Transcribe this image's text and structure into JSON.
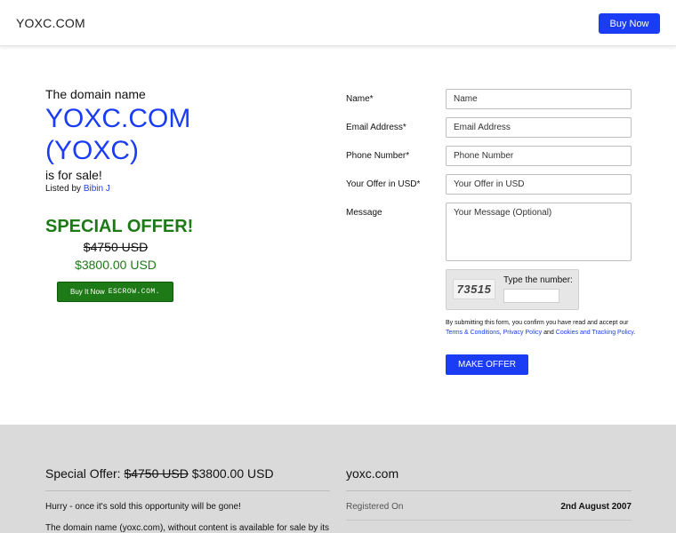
{
  "header": {
    "logo": "YOXC.COM",
    "buy_now_label": "Buy Now"
  },
  "listing": {
    "intro": "The domain name",
    "domain_line1": "YOXC.COM",
    "domain_line2": "(YOXC)",
    "for_sale": "is for sale!",
    "listed_by_prefix": "Listed by",
    "seller": "Bibin J"
  },
  "offer": {
    "special_label": "SPECIAL OFFER!",
    "old_price": "$4750 USD",
    "new_price": "$3800.00 USD",
    "escrow_button": {
      "prefix": "Buy It Now",
      "brand": "ESCROW.COM."
    }
  },
  "form": {
    "fields": [
      {
        "label": "Name*",
        "placeholder": "Name"
      },
      {
        "label": "Email Address*",
        "placeholder": "Email Address"
      },
      {
        "label": "Phone Number*",
        "placeholder": "Phone Number"
      },
      {
        "label": "Your Offer in USD*",
        "placeholder": "Your Offer in USD"
      }
    ],
    "message": {
      "label": "Message",
      "placeholder": "Your Message (Optional)"
    },
    "captcha": {
      "code": "73515",
      "label": "Type the number:"
    },
    "consent": {
      "text_before": "By submitting this form, you confirm you have read and accept our",
      "terms_link": "Terms & Conditions",
      "comma": ",",
      "privacy_link": "Privacy Policy",
      "and": "and",
      "cookies_link": "Cookies and Tracking Policy",
      "end": "."
    },
    "submit_label": "MAKE OFFER"
  },
  "footer": {
    "offer_prefix": "Special Offer:",
    "old_price": "$4750 USD",
    "new_price": "$3800.00 USD",
    "hurry": "Hurry - once it's sold this opportunity will be gone!",
    "description": "The domain name (yoxc.com), without content is available for sale by its",
    "domain": "yoxc.com",
    "registered_label": "Registered On",
    "registered_value": "2nd August 2007"
  },
  "colors": {
    "accent": "#1a3cf5",
    "offer_green": "#1d7a16",
    "footer_bg": "#dadada"
  }
}
